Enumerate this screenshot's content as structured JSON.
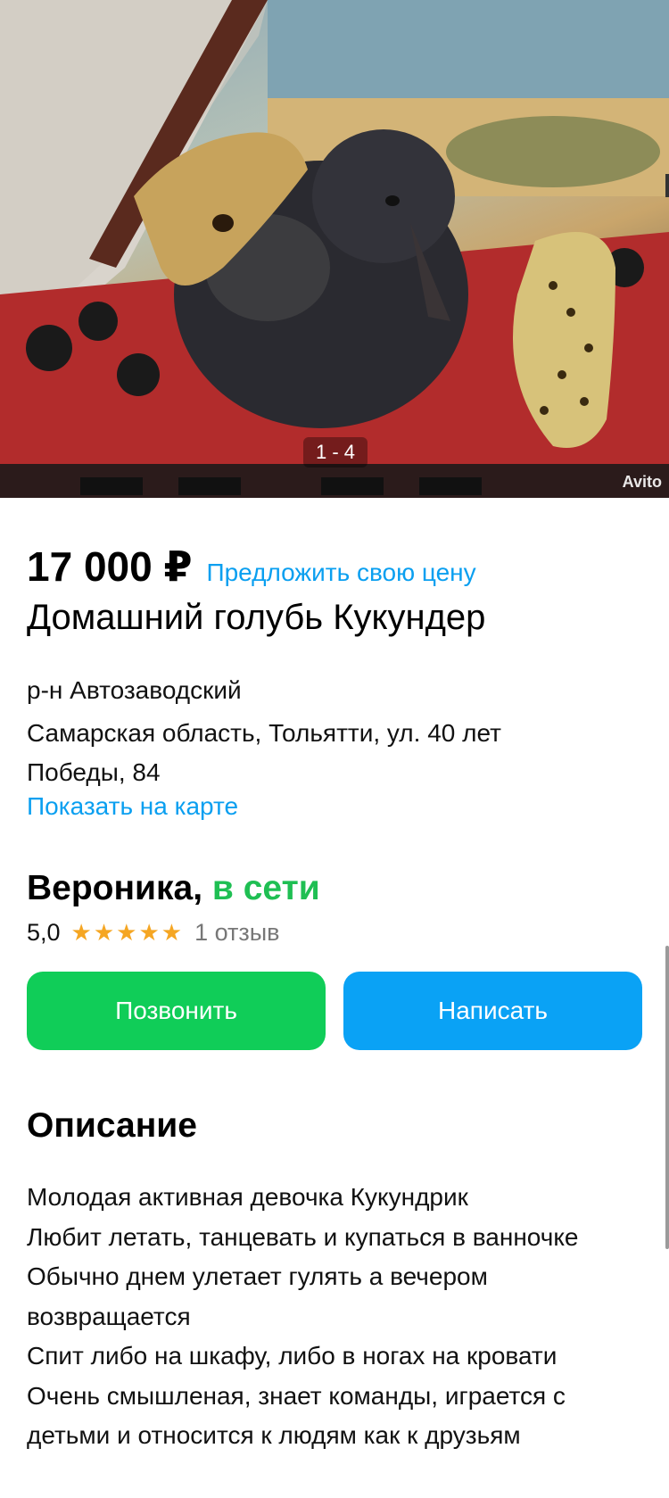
{
  "gallery": {
    "counter": "1 - 4",
    "watermark": "Avito"
  },
  "listing": {
    "price": "17 000 ₽",
    "offer_price_label": "Предложить свою цену",
    "title": "Домашний голубь Кукундер"
  },
  "location": {
    "district": "р-н Автозаводский",
    "address_line1": "Самарская область, Тольятти, ул. 40 лет",
    "address_line2": "Победы, 84",
    "show_on_map": "Показать на карте"
  },
  "seller": {
    "name": "Вероника,",
    "status": "в сети",
    "rating": "5,0",
    "stars": "★★★★★",
    "reviews": "1 отзыв"
  },
  "actions": {
    "call": "Позвонить",
    "write": "Написать"
  },
  "description": {
    "heading": "Описание",
    "lines": [
      "Молодая активная девочка Кукундрик",
      "Любит летать, танцевать и купаться в ванночке",
      "Обычно днем улетает гулять а вечером",
      "возвращается",
      "Спит либо на шкафу, либо в ногах на кровати",
      "Очень смышленая, знает команды, играется с",
      "детьми и относится к людям как к друзьям"
    ]
  },
  "colors": {
    "accent_link": "#0a9ff0",
    "online": "#1fbf53",
    "call_button": "#10cd58",
    "write_button": "#0aa2f5",
    "stars": "#f5a623"
  }
}
